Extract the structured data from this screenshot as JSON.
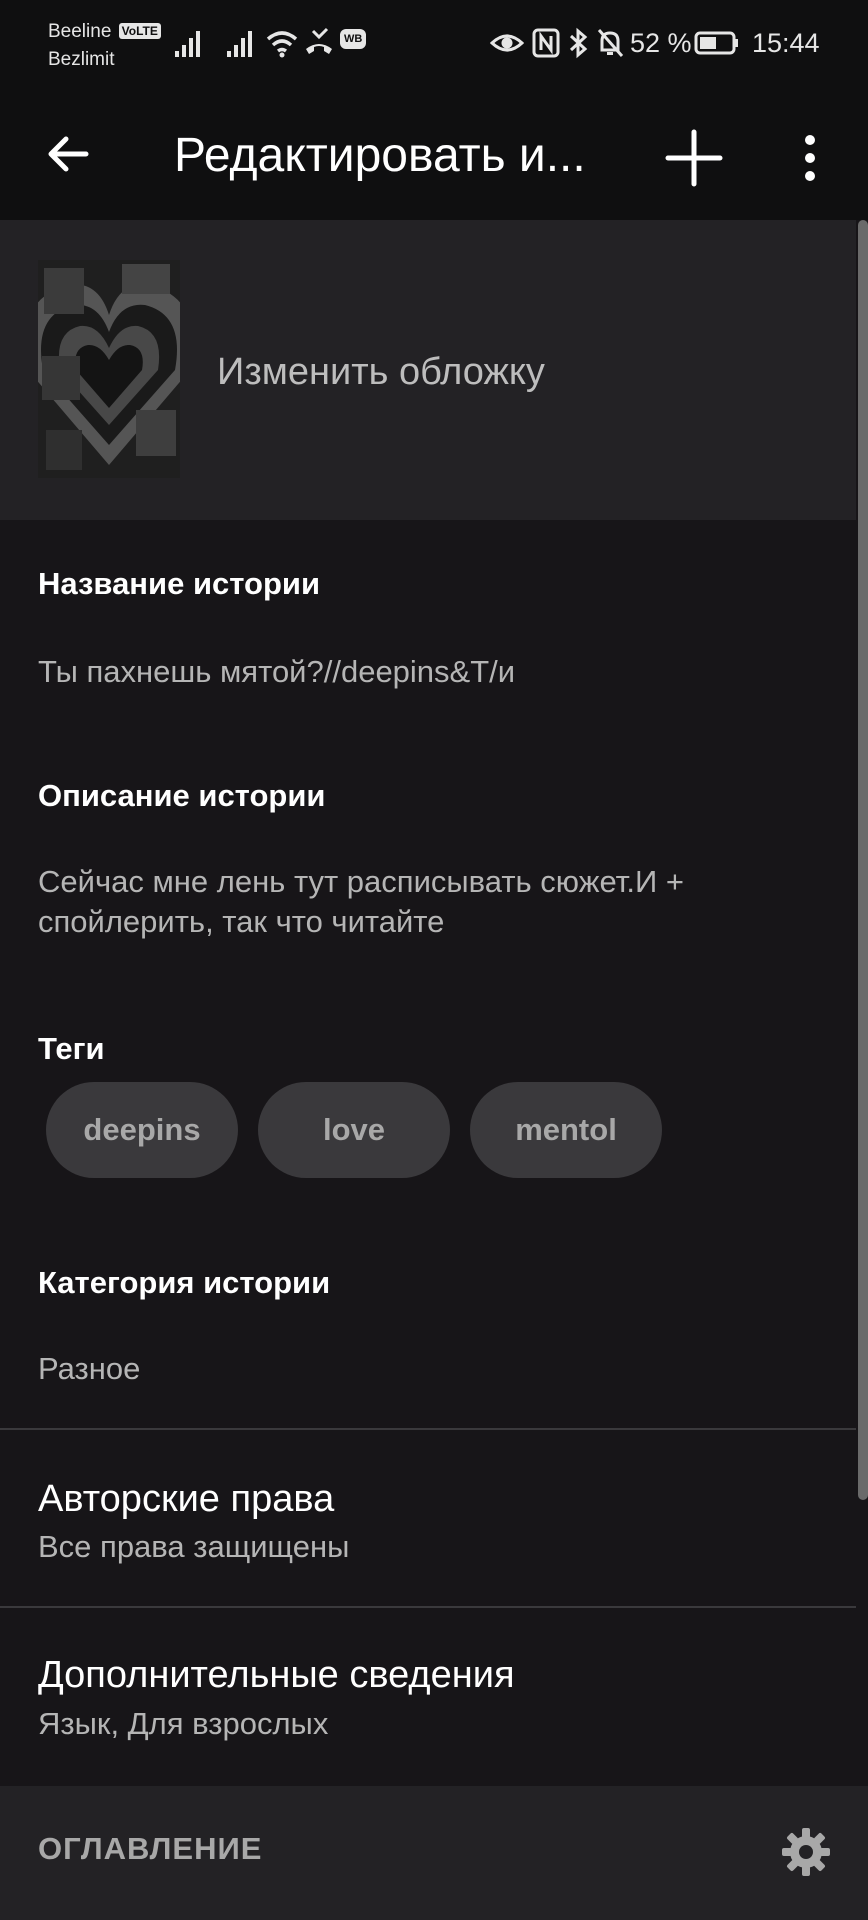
{
  "status_bar": {
    "carrier_line1": "Beeline",
    "volte_badge": "VoLTE",
    "carrier_line2": "Bezlimit",
    "wb_badge": "WB",
    "battery_percent": "52 %",
    "time": "15:44"
  },
  "toolbar": {
    "title": "Редактировать и..."
  },
  "cover": {
    "change_label": "Изменить обложку"
  },
  "story": {
    "title_label": "Название истории",
    "title_value": "Ты пахнешь мятой?//deepins&T/и",
    "description_label": "Описание истории",
    "description_value_line1": "Сейчас мне лень тут расписывать сюжет.И +",
    "description_value_line2": "спойлерить, так что читайте",
    "tags_label": "Теги",
    "tags": [
      "deepins",
      "love",
      "mentol"
    ],
    "category_label": "Категория истории",
    "category_value": "Разное"
  },
  "copyright": {
    "title": "Авторские права",
    "value": "Все права защищены"
  },
  "details": {
    "title": "Дополнительные сведения",
    "value": "Язык, Для взрослых"
  },
  "toc": {
    "label": "ОГЛАВЛЕНИЕ"
  }
}
